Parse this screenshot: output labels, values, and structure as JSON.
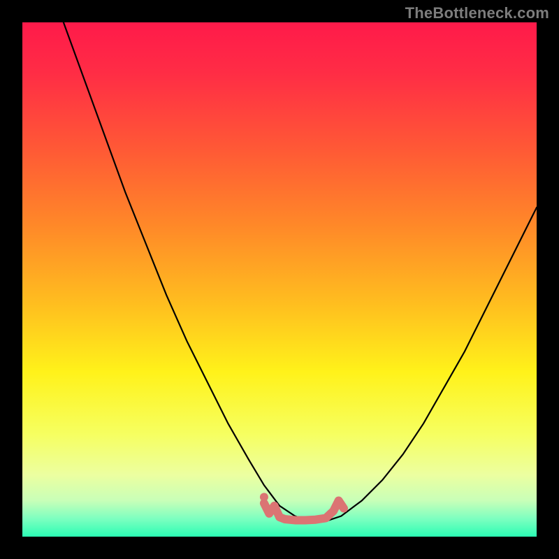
{
  "watermark": {
    "text": "TheBottleneck.com"
  },
  "colors": {
    "frame": "#000000",
    "curve": "#000000",
    "squiggle": "#db7473",
    "gradient_stops": [
      {
        "offset": 0.0,
        "color": "#ff1a4a"
      },
      {
        "offset": 0.1,
        "color": "#ff2d45"
      },
      {
        "offset": 0.25,
        "color": "#ff5a35"
      },
      {
        "offset": 0.4,
        "color": "#ff8a28"
      },
      {
        "offset": 0.55,
        "color": "#ffbf1f"
      },
      {
        "offset": 0.68,
        "color": "#fff21a"
      },
      {
        "offset": 0.8,
        "color": "#f6ff60"
      },
      {
        "offset": 0.88,
        "color": "#ecffa0"
      },
      {
        "offset": 0.93,
        "color": "#c8ffb8"
      },
      {
        "offset": 0.965,
        "color": "#7dffc0"
      },
      {
        "offset": 1.0,
        "color": "#2bfcb4"
      }
    ]
  },
  "chart_data": {
    "type": "line",
    "title": "",
    "xlabel": "",
    "ylabel": "",
    "xlim": [
      0,
      100
    ],
    "ylim": [
      0,
      100
    ],
    "series": [
      {
        "name": "bottleneck-curve",
        "x": [
          8,
          12,
          16,
          20,
          24,
          28,
          32,
          36,
          40,
          44,
          47,
          50,
          53,
          56,
          59,
          62,
          66,
          70,
          74,
          78,
          82,
          86,
          90,
          94,
          98,
          100
        ],
        "y": [
          100,
          89,
          78,
          67,
          57,
          47,
          38,
          30,
          22,
          15,
          10,
          6,
          4,
          3,
          3,
          4,
          7,
          11,
          16,
          22,
          29,
          36,
          44,
          52,
          60,
          64
        ]
      }
    ],
    "annotations": [
      {
        "name": "trough-squiggle",
        "type": "freeform",
        "points_xy": [
          [
            47,
            6.5
          ],
          [
            48,
            4.5
          ],
          [
            49,
            6.0
          ],
          [
            50,
            3.8
          ],
          [
            51,
            3.4
          ],
          [
            53,
            3.2
          ],
          [
            55,
            3.2
          ],
          [
            57,
            3.3
          ],
          [
            59,
            3.6
          ],
          [
            60.5,
            5.0
          ],
          [
            61.5,
            7.0
          ],
          [
            62.5,
            5.5
          ]
        ]
      }
    ]
  }
}
